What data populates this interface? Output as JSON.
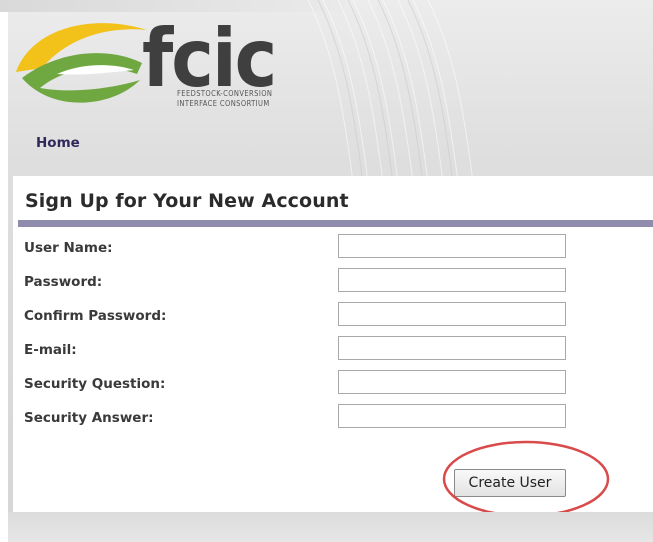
{
  "brand": {
    "logo_text": "fcic",
    "logo_subtitle_line1": "Feedstock-Conversion",
    "logo_subtitle_line2": "Interface Consortium",
    "accent_yellow": "#f2c21b",
    "accent_green": "#6fa840",
    "logo_gray": "#3f3f3f"
  },
  "nav": {
    "home_label": "Home"
  },
  "form": {
    "title": "Sign Up for Your New Account",
    "rule_color": "#8e8bac",
    "fields": [
      {
        "label": "User Name:",
        "value": ""
      },
      {
        "label": "Password:",
        "value": ""
      },
      {
        "label": "Confirm Password:",
        "value": ""
      },
      {
        "label": "E-mail:",
        "value": ""
      },
      {
        "label": "Security Question:",
        "value": ""
      },
      {
        "label": "Security Answer:",
        "value": ""
      }
    ],
    "submit_label": "Create User",
    "highlight_color": "#d94a4a"
  }
}
